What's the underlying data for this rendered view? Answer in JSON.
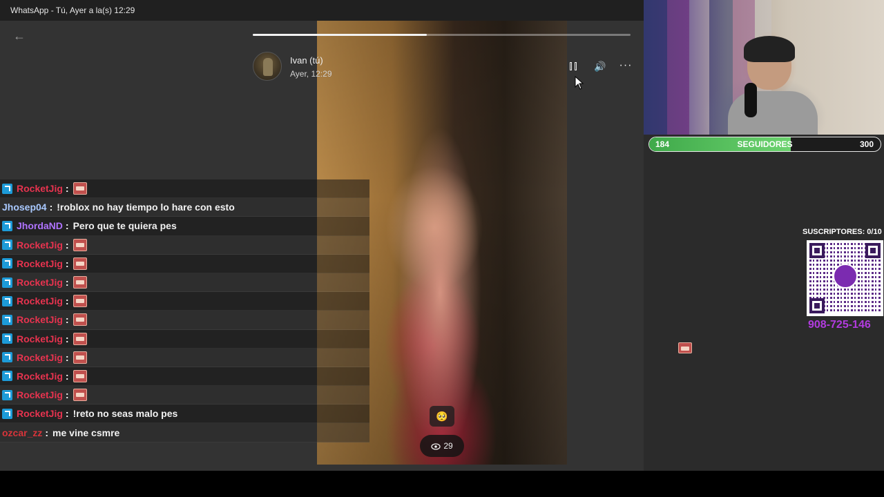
{
  "window": {
    "title": "WhatsApp - Tú, Ayer a la(s) 12:29"
  },
  "status": {
    "sender_name": "Ivan (tú)",
    "timestamp": "Ayer, 12:29",
    "progress_fraction": 0.46,
    "views": "29",
    "reaction_icon": "🥺"
  },
  "controls": {
    "back_icon": "arrow-left-icon",
    "volume_glyph": "🔊",
    "more_glyph": "···"
  },
  "chat": [
    {
      "user": "RocketJig",
      "color": "#e8334f",
      "badge": true,
      "message": "",
      "emote": true
    },
    {
      "user": "Jhosep04",
      "color": "#a9c9ff",
      "badge": false,
      "message": "!roblox no hay tiempo lo hare con esto",
      "emote": false
    },
    {
      "user": "JhordaND",
      "color": "#b074ff",
      "badge": true,
      "message": "Pero que te quiera pes",
      "emote": false
    },
    {
      "user": "RocketJig",
      "color": "#e8334f",
      "badge": true,
      "message": "",
      "emote": true
    },
    {
      "user": "RocketJig",
      "color": "#e8334f",
      "badge": true,
      "message": "",
      "emote": true
    },
    {
      "user": "RocketJig",
      "color": "#e8334f",
      "badge": true,
      "message": "",
      "emote": true
    },
    {
      "user": "RocketJig",
      "color": "#e8334f",
      "badge": true,
      "message": "",
      "emote": true
    },
    {
      "user": "RocketJig",
      "color": "#e8334f",
      "badge": true,
      "message": "",
      "emote": true
    },
    {
      "user": "RocketJig",
      "color": "#e8334f",
      "badge": true,
      "message": "",
      "emote": true
    },
    {
      "user": "RocketJig",
      "color": "#e8334f",
      "badge": true,
      "message": "",
      "emote": true
    },
    {
      "user": "RocketJig",
      "color": "#e8334f",
      "badge": true,
      "message": "",
      "emote": true
    },
    {
      "user": "RocketJig",
      "color": "#e8334f",
      "badge": true,
      "message": "",
      "emote": true
    },
    {
      "user": "RocketJig",
      "color": "#e8334f",
      "badge": true,
      "message": "!reto no seas malo pes",
      "emote": false
    },
    {
      "user": "ozcar_zz",
      "color": "#d8343a",
      "badge": false,
      "message": "me vine csmre",
      "emote": false
    }
  ],
  "stream": {
    "followers_current": "184",
    "followers_label": "SEGUIDORES",
    "followers_goal": "300",
    "followers_fraction": 0.613,
    "subs_label": "SUSCRIPTORES: 0/10",
    "phone": "908-725-146",
    "accent_color": "#b23be0"
  }
}
